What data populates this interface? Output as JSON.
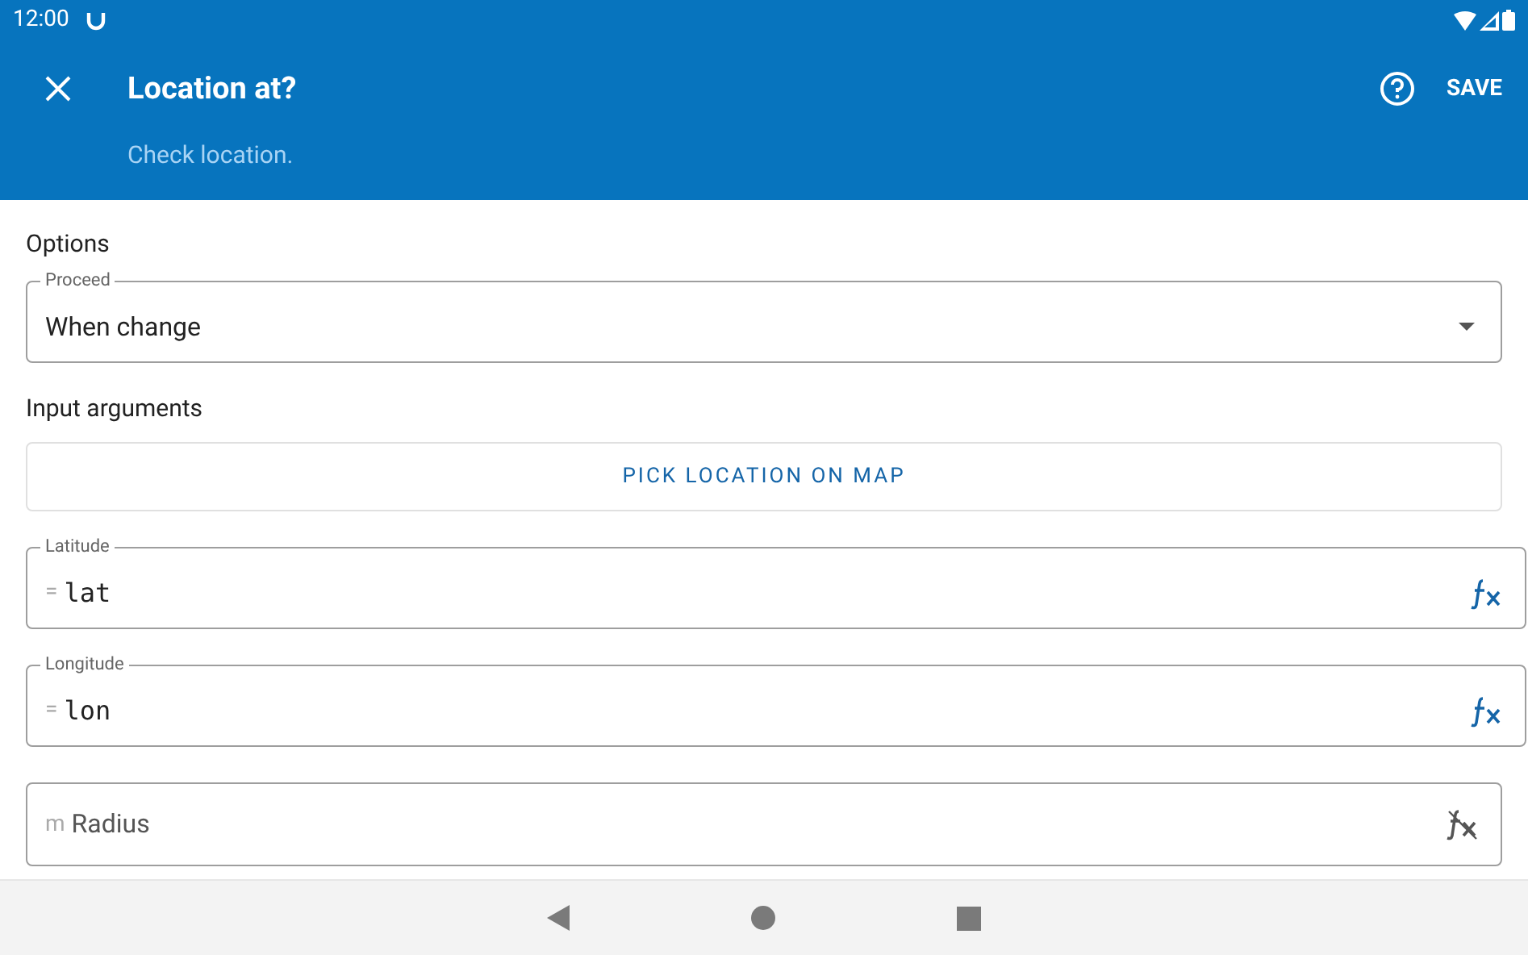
{
  "status_bar": {
    "time": "12:00"
  },
  "app_bar": {
    "title": "Location at?",
    "subtitle": "Check location.",
    "action": "SAVE"
  },
  "options": {
    "heading": "Options",
    "select": {
      "label": "Proceed",
      "value": "When change"
    }
  },
  "arguments": {
    "heading": "Input arguments",
    "button": "PICK LOCATION ON MAP",
    "fields": [
      {
        "label": "Latitude",
        "prefix": "=",
        "value": "lat",
        "formula": true
      },
      {
        "label": "Longitude",
        "prefix": "=",
        "value": "lon",
        "formula": true
      },
      {
        "prefix": "m",
        "placeholder": "Radius",
        "formula": false
      }
    ]
  }
}
